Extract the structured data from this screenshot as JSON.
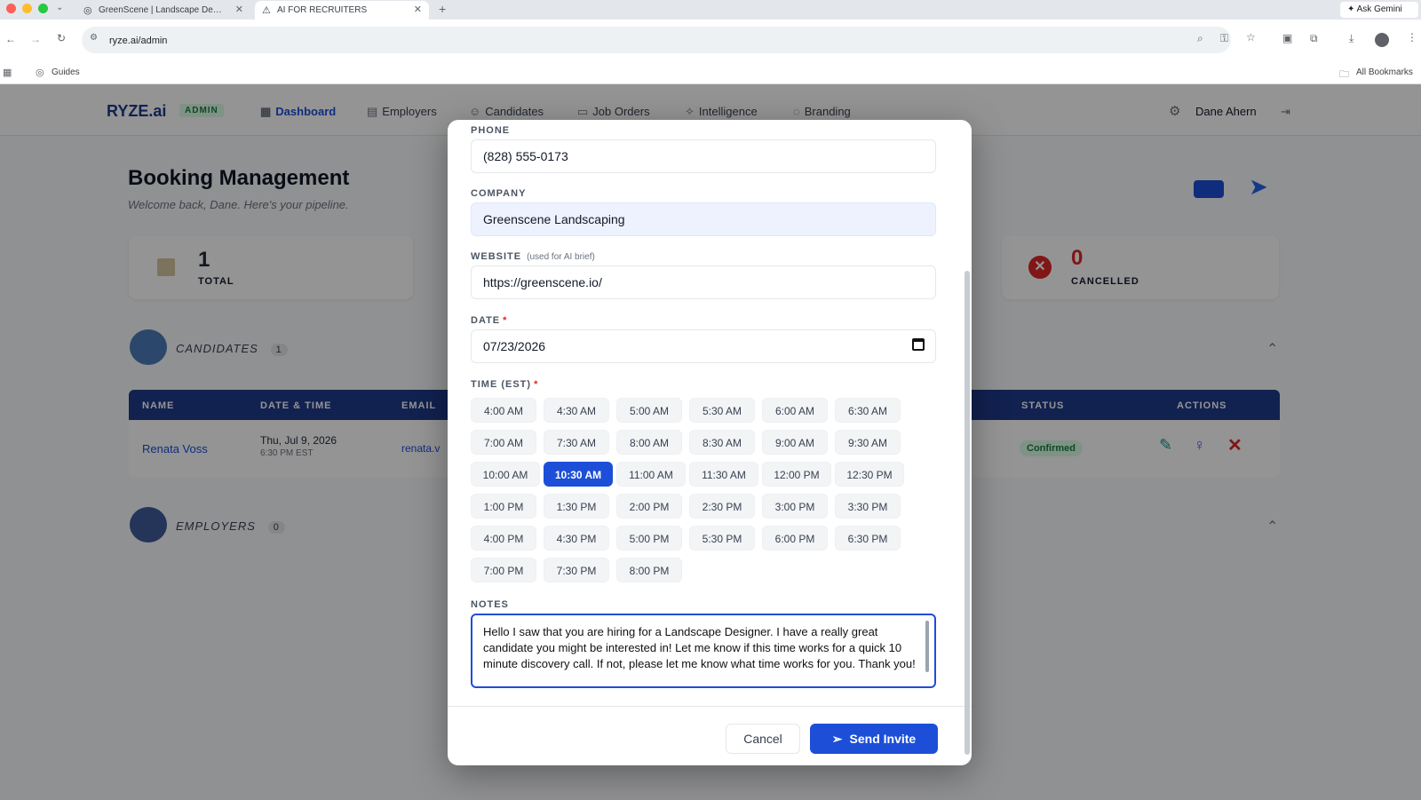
{
  "browser": {
    "tabs": [
      {
        "title": "GreenScene | Landscape De…",
        "icon": "globe-icon"
      },
      {
        "title": "AI FOR RECRUITERS",
        "icon": "warning-icon"
      }
    ],
    "ask_gemini": "Ask Gemini",
    "url": "ryze.ai/admin",
    "bookmarks": {
      "guides": "Guides",
      "all_bookmarks": "All Bookmarks"
    }
  },
  "app": {
    "logo": "RYZE.ai",
    "admin_badge": "ADMIN",
    "nav": [
      "Dashboard",
      "Employers",
      "Candidates",
      "Job Orders",
      "Intelligence",
      "Branding"
    ],
    "user_name": "Dane Ahern",
    "page_title": "Booking Management",
    "subtitle": "Welcome back, Dane. Here's your pipeline.",
    "stats": {
      "total": {
        "value": "1",
        "label": "TOTAL"
      },
      "cancelled": {
        "value": "0",
        "label": "CANCELLED"
      }
    },
    "candidates_section": {
      "title": "CANDIDATES",
      "count": "1"
    },
    "employers_section": {
      "title": "EMPLOYERS",
      "count": "0"
    },
    "table": {
      "headers": [
        "NAME",
        "DATE & TIME",
        "EMAIL",
        "STATUS",
        "ACTIONS"
      ],
      "row": {
        "name": "Renata Voss",
        "date": "Thu, Jul 9, 2026",
        "time": "6:30 PM EST",
        "email": "renata.v",
        "status": "Confirmed"
      }
    }
  },
  "modal": {
    "phone": {
      "label": "PHONE",
      "value": "(828) 555-0173"
    },
    "company": {
      "label": "COMPANY",
      "value": "Greenscene Landscaping"
    },
    "website": {
      "label": "WEBSITE",
      "hint": "(used for AI brief)",
      "value": "https://greenscene.io/"
    },
    "date": {
      "label": "DATE",
      "value": "07/23/2026"
    },
    "time": {
      "label": "TIME (EST)",
      "selected": "10:30 AM"
    },
    "time_rows": [
      [
        "4:00 AM",
        "4:30 AM",
        "5:00 AM",
        "5:30 AM",
        "6:00 AM",
        "6:30 AM"
      ],
      [
        "7:00 AM",
        "7:30 AM",
        "8:00 AM",
        "8:30 AM",
        "9:00 AM",
        "9:30 AM"
      ],
      [
        "10:00 AM",
        "10:30 AM",
        "11:00 AM",
        "11:30 AM",
        "12:00 PM",
        "12:30 PM"
      ],
      [
        "1:00 PM",
        "1:30 PM",
        "2:00 PM",
        "2:30 PM",
        "3:00 PM",
        "3:30 PM"
      ],
      [
        "4:00 PM",
        "4:30 PM",
        "5:00 PM",
        "5:30 PM",
        "6:00 PM",
        "6:30 PM"
      ],
      [
        "7:00 PM",
        "7:30 PM",
        "8:00 PM"
      ]
    ],
    "notes": {
      "label": "NOTES",
      "value": "Hello I saw that you are hiring for a Landscape Designer.  I have a really great candidate you might be interested in!  Let me know if this time works for a quick 10 minute discovery call.  If not, please let me know what time works for you.  Thank you!"
    },
    "cancel_label": "Cancel",
    "send_label": "Send Invite"
  }
}
